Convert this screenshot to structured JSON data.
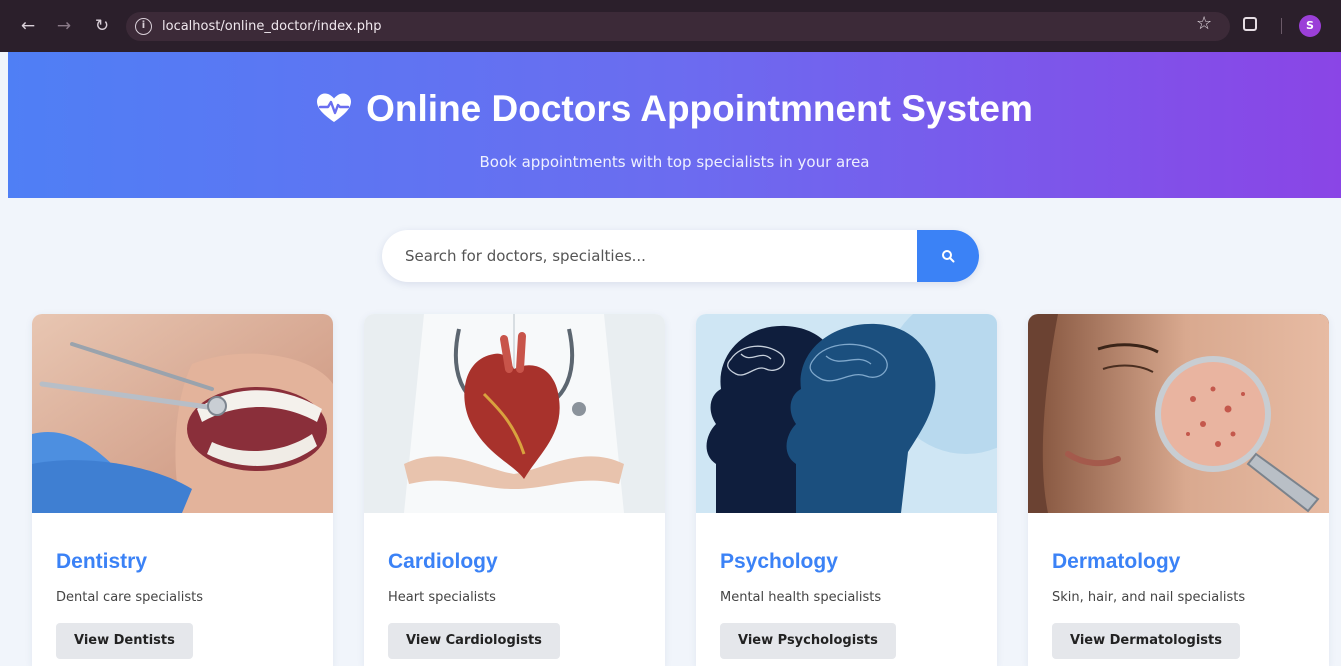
{
  "browser": {
    "url": "localhost/online_doctor/index.php",
    "profile_initial": "S"
  },
  "hero": {
    "title": "Online Doctors Appointmnent System",
    "subtitle": "Book appointments with top specialists in your area"
  },
  "search": {
    "placeholder": "Search for doctors, specialties..."
  },
  "cards": [
    {
      "title": "Dentistry",
      "description": "Dental care specialists",
      "button": "View Dentists"
    },
    {
      "title": "Cardiology",
      "description": "Heart specialists",
      "button": "View Cardiologists"
    },
    {
      "title": "Psychology",
      "description": "Mental health specialists",
      "button": "View Psychologists"
    },
    {
      "title": "Dermatology",
      "description": "Skin, hair, and nail specialists",
      "button": "View Dermatologists"
    }
  ],
  "colors": {
    "accent": "#3b82f6",
    "hero_start": "#4f7ff5",
    "hero_end": "#8a45e6"
  },
  "icons": {
    "hero": "heartbeat-icon",
    "search": "search-icon"
  }
}
